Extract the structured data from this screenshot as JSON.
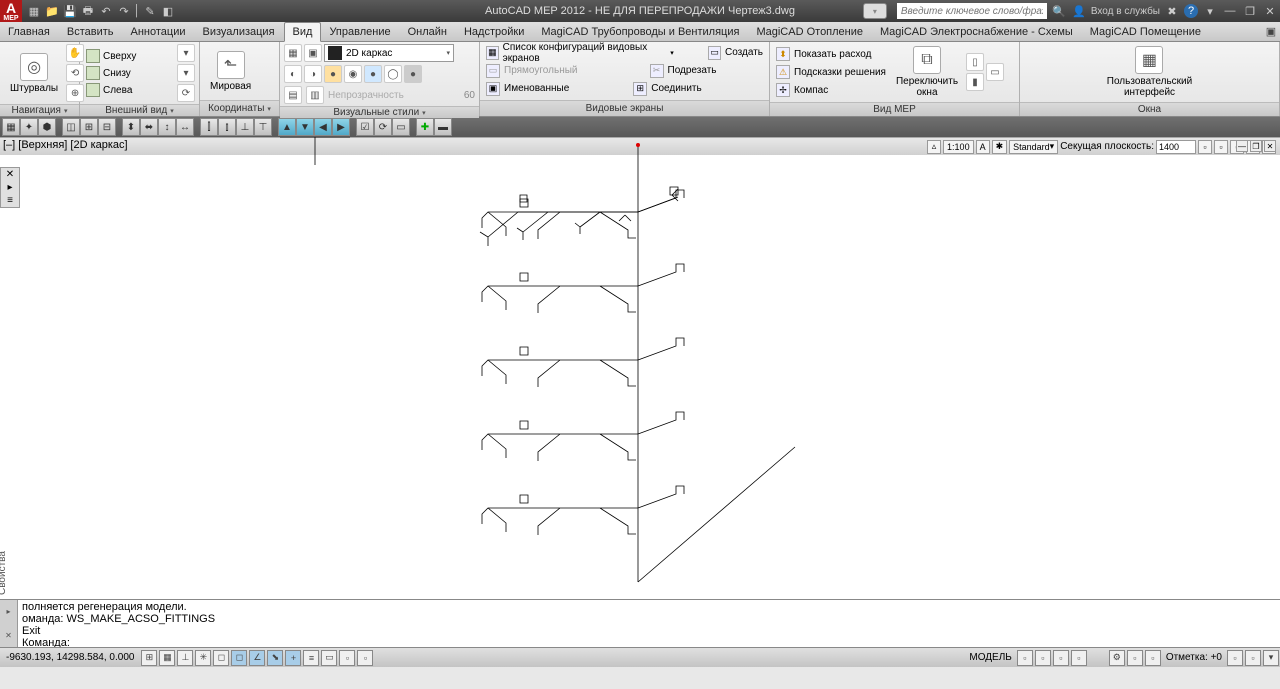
{
  "app": {
    "title": "AutoCAD MEP 2012 - НЕ ДЛЯ ПЕРЕПРОДАЖИ    Чертеж3.dwg",
    "search_placeholder": "Введите ключевое слово/фразу",
    "login": "Вход в службы"
  },
  "tabs": [
    "Главная",
    "Вставить",
    "Аннотации",
    "Визуализация",
    "Вид",
    "Управление",
    "Онлайн",
    "Надстройки",
    "MagiCAD Трубопроводы и Вентиляция",
    "MagiCAD Отопление",
    "MagiCAD Электроснабжение - Схемы",
    "MagiCAD Помещение"
  ],
  "active_tab_index": 4,
  "ribbon": {
    "nav": {
      "title": "Навигация",
      "btn": "Штурвалы"
    },
    "view": {
      "title": "Внешний вид",
      "items": [
        "Сверху",
        "Снизу",
        "Слева"
      ]
    },
    "coord": {
      "title": "Координаты",
      "btn": "Мировая"
    },
    "vstyle": {
      "title": "Визуальные стили",
      "sel": "2D каркас",
      "opacity_label": "Непрозрачность",
      "opacity_val": "60"
    },
    "vports": {
      "title": "Видовые экраны",
      "conf": "Список конфигураций видовых экранов",
      "create": "Создать",
      "rect": "Прямоугольный",
      "crop": "Подрезать",
      "named": "Именованные",
      "join": "Соединить"
    },
    "mep": {
      "title": "Вид MEP",
      "flow": "Показать расход",
      "hints": "Подсказки решения",
      "compass": "Компас",
      "switch": "Переключить\nокна"
    },
    "win": {
      "title": "Окна",
      "ui": "Пользовательский\nинтерфейс"
    }
  },
  "viewport_label": "[–] [Верхняя] [2D каркас]",
  "palette_vtab": "Свойства",
  "draw_status": {
    "scale": "1:100",
    "std": "Standard",
    "cut": "Секущая плоскость:",
    "cut_val": "1400"
  },
  "cmd_lines": [
    "полняется регенерация модели.",
    "оманда: WS_MAKE_ACSO_FITTINGS",
    "Exit",
    "",
    "Команда:"
  ],
  "status": {
    "coords": "-9630.193, 14298.584, 0.000",
    "model": "МОДЕЛЬ",
    "mark": "Отметка: +0"
  }
}
